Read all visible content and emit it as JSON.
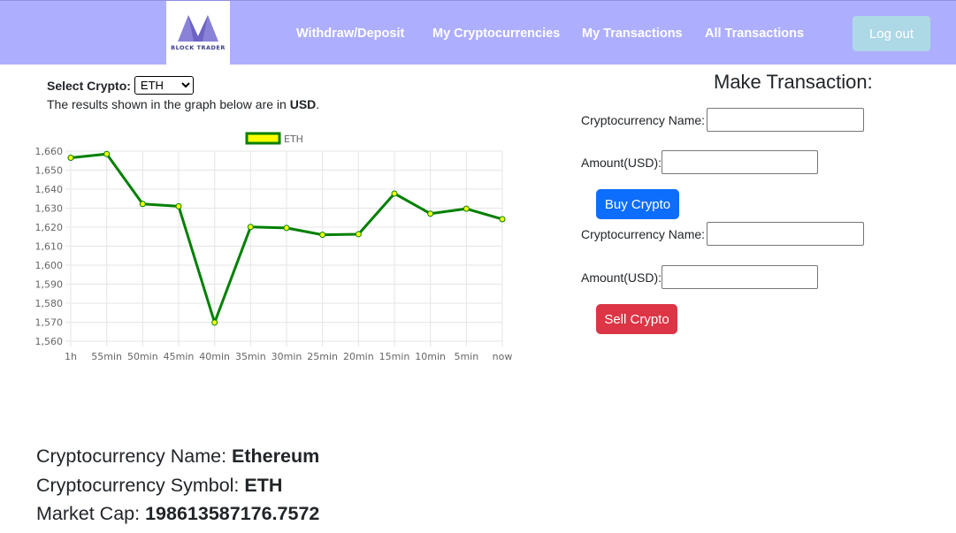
{
  "nav": {
    "logo_text": "BLOCK TRADER",
    "links": [
      "Withdraw/Deposit",
      "My Cryptocurrencies",
      "My Transactions",
      "All Transactions"
    ],
    "logout_label": "Log out",
    "bar_color": "#aeaeff"
  },
  "crypto_select": {
    "label": "Select Crypto:",
    "selected": "ETH",
    "note_prefix": "The results shown in the graph below are in ",
    "note_currency": "USD",
    "note_suffix": "."
  },
  "chart_data": {
    "type": "line",
    "categories": [
      "1h",
      "55min",
      "50min",
      "45min",
      "40min",
      "35min",
      "30min",
      "25min",
      "20min",
      "15min",
      "10min",
      "5min",
      "now"
    ],
    "series": [
      {
        "name": "ETH",
        "values": [
          1656.5,
          1658.5,
          1632.2,
          1631.0,
          1569.8,
          1620.1,
          1619.6,
          1616.0,
          1616.3,
          1637.7,
          1627.1,
          1629.7,
          1624.2
        ],
        "line_color": "#008000",
        "point_color": "#ffff00"
      }
    ],
    "ylim": [
      1560,
      1660
    ],
    "yticks": [
      "1,660",
      "1,650",
      "1,640",
      "1,630",
      "1,620",
      "1,610",
      "1,600",
      "1,590",
      "1,580",
      "1,570",
      "1,560"
    ],
    "grid": true,
    "legend": "top"
  },
  "transaction": {
    "title": "Make Transaction:",
    "buy": {
      "name_label": "Cryptocurrency Name:",
      "amount_label": "Amount(USD):",
      "button_label": "Buy Crypto"
    },
    "sell": {
      "name_label": "Cryptocurrency Name:",
      "amount_label": "Amount(USD):",
      "button_label": "Sell Crypto"
    },
    "buy_color": "#0d6efd",
    "sell_color": "#dc3545"
  },
  "info": {
    "name_label": "Cryptocurrency Name: ",
    "name_value": "Ethereum",
    "symbol_label": "Cryptocurrency Symbol: ",
    "symbol_value": "ETH",
    "market_cap_label": "Market Cap: ",
    "market_cap_value": "198613587176.7572"
  }
}
